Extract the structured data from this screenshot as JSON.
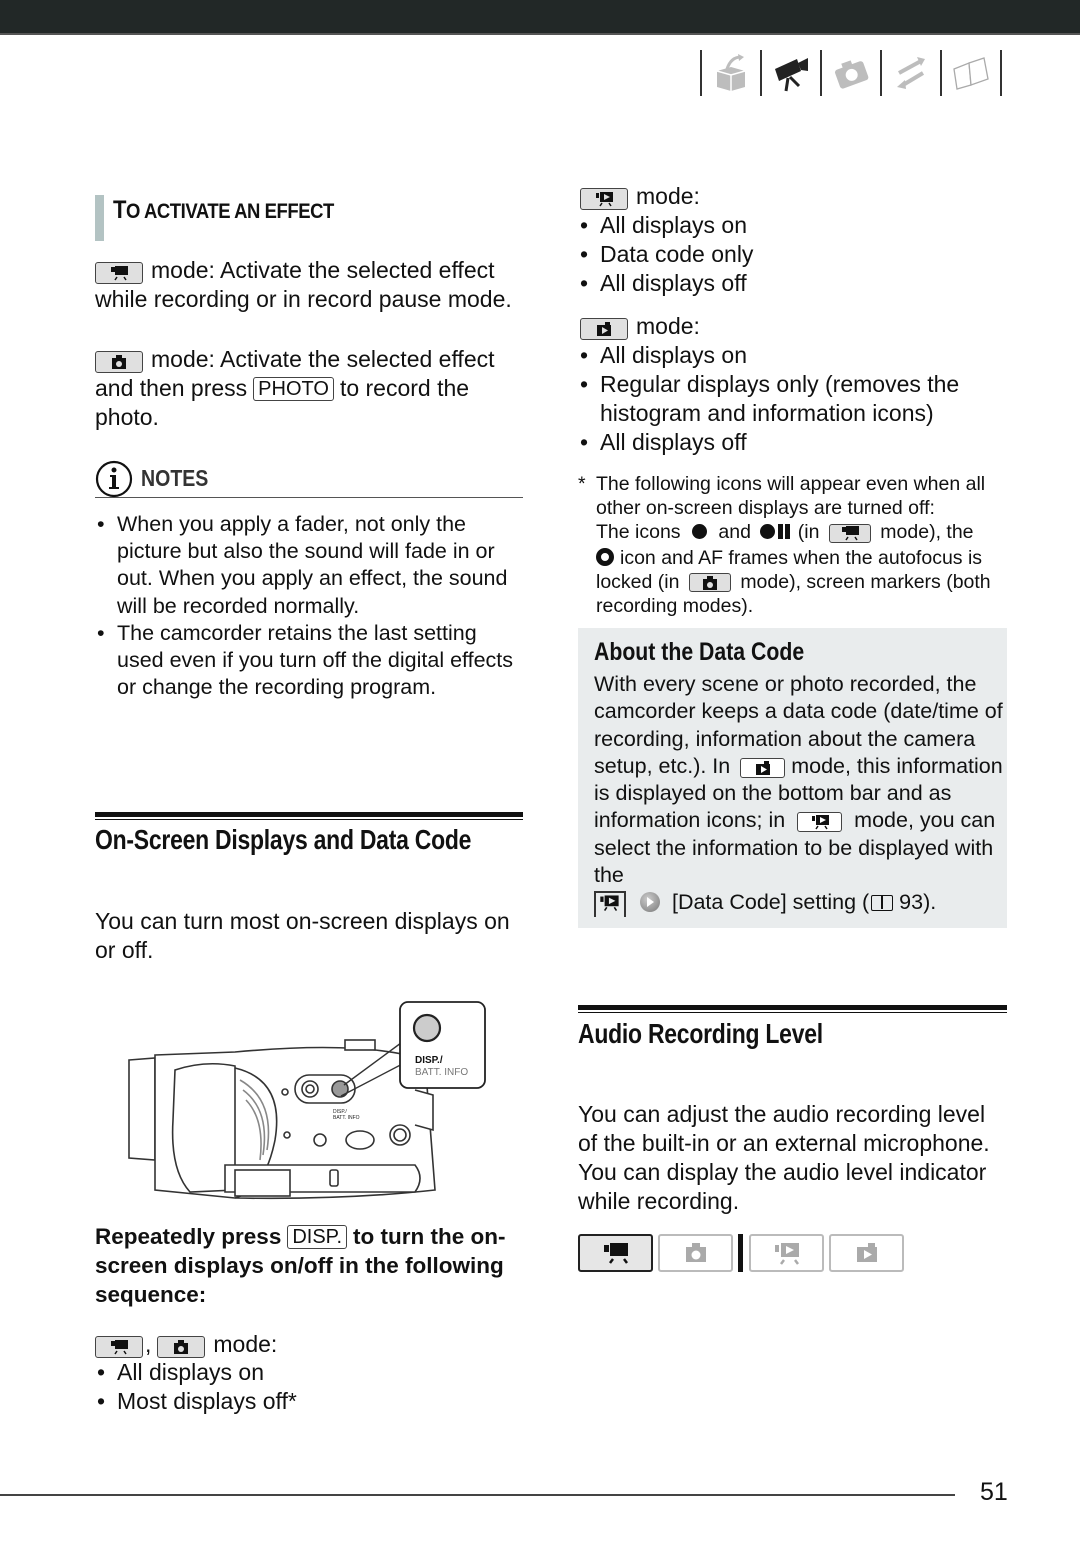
{
  "header": {
    "nav_icons": [
      {
        "name": "introduction-box-icon",
        "active": false
      },
      {
        "name": "movie-camera-icon",
        "active": true
      },
      {
        "name": "photo-camera-icon",
        "active": false
      },
      {
        "name": "transfer-arrows-icon",
        "active": false
      },
      {
        "name": "book-icon",
        "active": false
      }
    ]
  },
  "left_column": {
    "subheading_first": "T",
    "subheading_first2": "O",
    "subheading_rest": " ACTIVATE AN EFFECT",
    "movie_mode_text": "mode: Activate the selected effect while recording or in record pause mode.",
    "photo_mode_text_1": "mode: Activate the selected effect and then press",
    "photo_key": "PHOTO",
    "photo_mode_text_2": "to record the photo.",
    "notes": {
      "label": "NOTES",
      "items": [
        "When you apply a fader, not only the picture but also the sound will fade in or out. When you apply an effect, the sound will be recorded normally.",
        "The camcorder retains the last setting used even if you turn off the digital effects or change the recording program."
      ]
    },
    "section_title": "On-Screen Displays and Data Code",
    "section_intro": "You can turn most on-screen displays on or off.",
    "illustration": {
      "callout_label_1": "DISP./",
      "callout_label_2": "BATT. INFO",
      "body_label_1": "DISP./",
      "body_label_2": "BATT. INFO"
    },
    "instruction_1": "Repeatedly press",
    "instruction_key": "DISP.",
    "instruction_2": "to turn the on-screen displays on/off in the following sequence:",
    "recording_modes": {
      "separator": ",",
      "label": "mode:",
      "items": [
        "All displays on",
        "Most displays off*"
      ]
    }
  },
  "right_column": {
    "movie_playback": {
      "label": "mode:",
      "items": [
        "All displays on",
        "Data code only",
        "All displays off"
      ]
    },
    "photo_playback": {
      "label": "mode:",
      "items": [
        "All displays on",
        "Regular displays only (removes the histogram and information icons)",
        "All displays off"
      ]
    },
    "footnote": {
      "marker": "*",
      "line1": "The following icons will appear even when all other on-screen displays are turned off:",
      "line2a": "The icons",
      "line2b": "and",
      "line2c": "(in",
      "line2d": "mode), the",
      "line3": "icon and AF frames when the autofocus is locked (in",
      "line4": "mode), screen markers (both recording modes)."
    },
    "data_code_box": {
      "title": "About the Data Code",
      "text_1": "With every scene or photo recorded, the camcorder keeps a data code (date/time of recording, information about the camera setup, etc.). In",
      "text_2": "mode, this information is displayed on the bottom bar and as information icons; in",
      "text_3": "mode, you can select the information to be displayed with the",
      "text_4": "[Data Code] setting (",
      "page_ref": "93",
      "text_5": ")."
    },
    "audio_section": {
      "title": "Audio Recording Level",
      "body": "You can adjust the audio recording level of the built-in or an external microphone. You can display the audio level indicator while recording."
    },
    "mode_buttons": [
      {
        "name": "movie-record-mode",
        "active": true
      },
      {
        "name": "photo-record-mode",
        "active": false
      },
      {
        "name": "movie-playback-mode",
        "active": false
      },
      {
        "name": "photo-playback-mode",
        "active": false
      }
    ]
  },
  "footer": {
    "page_number": "51"
  }
}
